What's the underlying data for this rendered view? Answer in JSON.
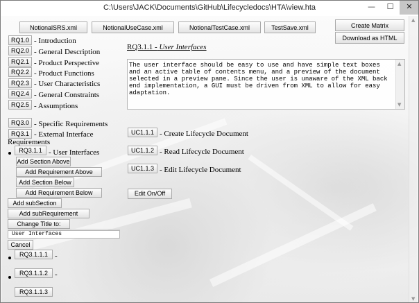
{
  "window": {
    "title": "C:\\Users\\JACK\\Documents\\GitHub\\Lifecycledocs\\HTA\\view.hta",
    "min_glyph": "—",
    "max_glyph": "☐",
    "close_glyph": "✕"
  },
  "toolbar": {
    "files": [
      "NotionalSRS.xml",
      "NotionalUseCase.xml",
      "NotionalTestCase.xml",
      "TestSave.xml"
    ],
    "create_matrix": "Create Matrix",
    "download_html": "Download as HTML"
  },
  "sidebar": {
    "items": [
      {
        "id": "RQ1.0",
        "label": "- Introduction"
      },
      {
        "id": "RQ2.0",
        "label": "- General Description"
      },
      {
        "id": "RQ2.1",
        "label": "- Product Perspective"
      },
      {
        "id": "RQ2.2",
        "label": "- Product Functions"
      },
      {
        "id": "RQ2.3",
        "label": "- User Characteristics"
      },
      {
        "id": "RQ2.4",
        "label": "- General Constraints"
      },
      {
        "id": "RQ2.5",
        "label": "- Assumptions"
      },
      {
        "id": "RQ3.0",
        "label": "- Specific Requirements"
      },
      {
        "id": "RQ3.1",
        "label": "- External Interface"
      }
    ],
    "requirements_label": "Requirements",
    "selected": {
      "id": "RQ3.1.1",
      "label": "- User Interfaces"
    },
    "actions": {
      "add_section_above": "Add Section Above",
      "add_requirement_above": "Add Requirement Above",
      "add_section_below": "Add Section Below",
      "add_requirement_below": "Add Requirement Below",
      "add_subsection": "Add subSection",
      "add_subrequirement": "Add subRequirement",
      "change_title": "Change Title to:",
      "cancel": "Cancel"
    },
    "title_input_value": "User Interfaces",
    "children": [
      {
        "id": "RQ3.1.1.1",
        "label": "-"
      },
      {
        "id": "RQ3.1.1.2",
        "label": "-"
      },
      {
        "id": "RQ3.1.1.3",
        "label": ""
      }
    ]
  },
  "main": {
    "heading_id": "RQ3.1.1 -",
    "heading_title": "User Interfaces",
    "description": "The user interface should be easy to use and have simple text boxes and an active table of contents menu, and a preview of the document selected in a preview pane. Since the user is unaware of the XML back end implementation, a GUI must be driven from XML to allow for easy adaptation.",
    "use_cases": [
      {
        "id": "UC1.1.1",
        "label": "- Create Lifecycle Document"
      },
      {
        "id": "UC1.1.2",
        "label": "- Read Lifecycle Document"
      },
      {
        "id": "UC1.1.3",
        "label": "- Edit Lifecycle Document"
      }
    ],
    "edit_toggle": "Edit On/Off"
  }
}
